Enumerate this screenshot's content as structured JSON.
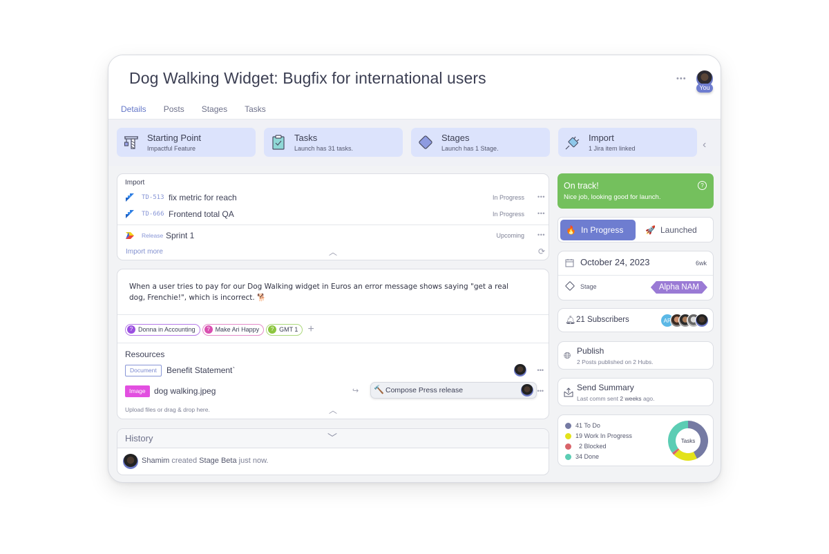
{
  "header": {
    "title": "Dog Walking Widget: Bugfix for international users",
    "more_label": "•••",
    "user_badge": "You"
  },
  "tabs": [
    {
      "label": "Details",
      "active": true
    },
    {
      "label": "Posts",
      "active": false
    },
    {
      "label": "Stages",
      "active": false
    },
    {
      "label": "Tasks",
      "active": false
    }
  ],
  "summary_cards": [
    {
      "icon": "crane-icon",
      "title": "Starting Point",
      "subtitle": "Impactful Feature"
    },
    {
      "icon": "clipboard-check-icon",
      "title": "Tasks",
      "subtitle": "Launch has 31 tasks."
    },
    {
      "icon": "diamond-icon",
      "title": "Stages",
      "subtitle": "Launch has 1 Stage."
    },
    {
      "icon": "plug-icon",
      "title": "Import",
      "subtitle": "1 Jira item linked"
    }
  ],
  "import": {
    "title": "Import",
    "items": [
      {
        "icon": "jira-icon",
        "key": "TD-513",
        "name": "fix metric for reach",
        "status": "In Progress"
      },
      {
        "icon": "jira-icon",
        "key": "TD-666",
        "name": "Frontend total QA",
        "status": "In Progress"
      }
    ],
    "release": {
      "icon": "release-icon",
      "key": "Release",
      "name": "Sprint 1",
      "status": "Upcoming"
    },
    "more_label": "Import more",
    "dots": "•••"
  },
  "description": {
    "text": "When a user tries to pay for our Dog Walking widget in Euros an error message shows saying \"get a real dog, Frenchie!\", which is incorrect. 🐕",
    "tags": [
      {
        "label": "Donna in Accounting",
        "color": "#9b4fe0"
      },
      {
        "label": "Make Ari Happy",
        "color": "#d94fb0"
      },
      {
        "label": "GMT 1",
        "color": "#8cc63f"
      }
    ],
    "add_tag": "+"
  },
  "resources": {
    "title": "Resources",
    "items": [
      {
        "type": "Document",
        "name": "Benefit Statement`"
      },
      {
        "type": "Image",
        "name": "dog walking.jpeg",
        "linked_task": "Compose Press release",
        "linked_task_icon": "🔨"
      }
    ],
    "upload_label": "Upload files or drag & drop here."
  },
  "history": {
    "title": "History",
    "entries": [
      {
        "user": "Shamim",
        "action": "created",
        "object": "Stage Beta",
        "time": "just now."
      }
    ]
  },
  "health": {
    "title": "On track!",
    "subtitle": "Nice job, looking good for launch.",
    "help": "?",
    "color": "#74c05d"
  },
  "launch_status": {
    "options": [
      {
        "label": "In Progress",
        "emoji": "🔥",
        "selected": true
      },
      {
        "label": "Launched",
        "emoji": "🚀",
        "selected": false
      }
    ],
    "accent": "#6e7dd0"
  },
  "schedule": {
    "date": "October 24, 2023",
    "relative": "6wk",
    "stage_label": "Stage",
    "stage_value": "Alpha NAM"
  },
  "subscribers": {
    "label": "21 Subscribers",
    "initials": "AP"
  },
  "publish": {
    "title": "Publish",
    "subtitle_count": "2 Posts",
    "subtitle_rest": "published on 2 Hubs."
  },
  "send_summary": {
    "title": "Send Summary",
    "subtitle_prefix": "Last comm sent",
    "subtitle_value": "2 weeks",
    "subtitle_suffix": "ago."
  },
  "chart_data": {
    "type": "pie",
    "title": "Tasks",
    "categories": [
      "To Do",
      "Work In Progress",
      "Blocked",
      "Done"
    ],
    "values": [
      41,
      19,
      2,
      34
    ],
    "colors": [
      "#757aa3",
      "#e3e21a",
      "#d9646a",
      "#5ccdb4"
    ],
    "legend_labels": [
      "41 To Do",
      "19 Work In Progress",
      "  2 Blocked",
      "34 Done"
    ],
    "legend": "left"
  }
}
